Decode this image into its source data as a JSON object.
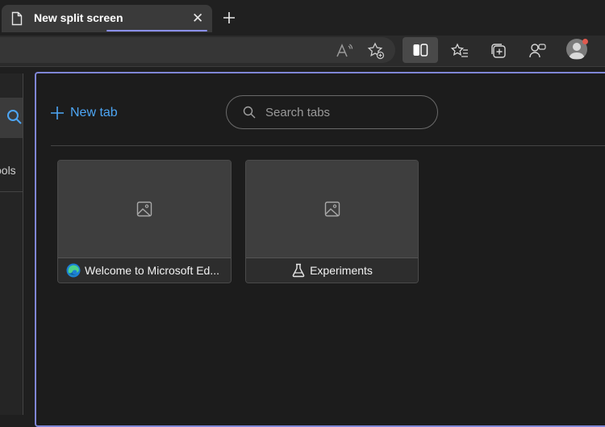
{
  "browser": {
    "active_tab": {
      "title": "New split screen",
      "icon": "page-icon",
      "close_icon": "close-icon"
    },
    "new_tab_icon": "plus-icon",
    "accent_color": "#7f86d6"
  },
  "toolbar": {
    "icons": [
      "read-aloud-icon",
      "add-favorite-icon",
      "split-screen-icon",
      "favorites-icon",
      "collections-icon",
      "feedback-icon",
      "profile-avatar"
    ]
  },
  "left_pane": {
    "partial_label": "ools"
  },
  "split_pane": {
    "new_tab_label": "New tab",
    "search": {
      "placeholder": "Search tabs"
    },
    "tabs": [
      {
        "title": "Welcome to Microsoft Ed...",
        "favicon": "edge-logo-icon",
        "thumbnail": "image-placeholder-icon"
      },
      {
        "title": "Experiments",
        "favicon": "flask-icon",
        "thumbnail": "image-placeholder-icon"
      }
    ]
  }
}
